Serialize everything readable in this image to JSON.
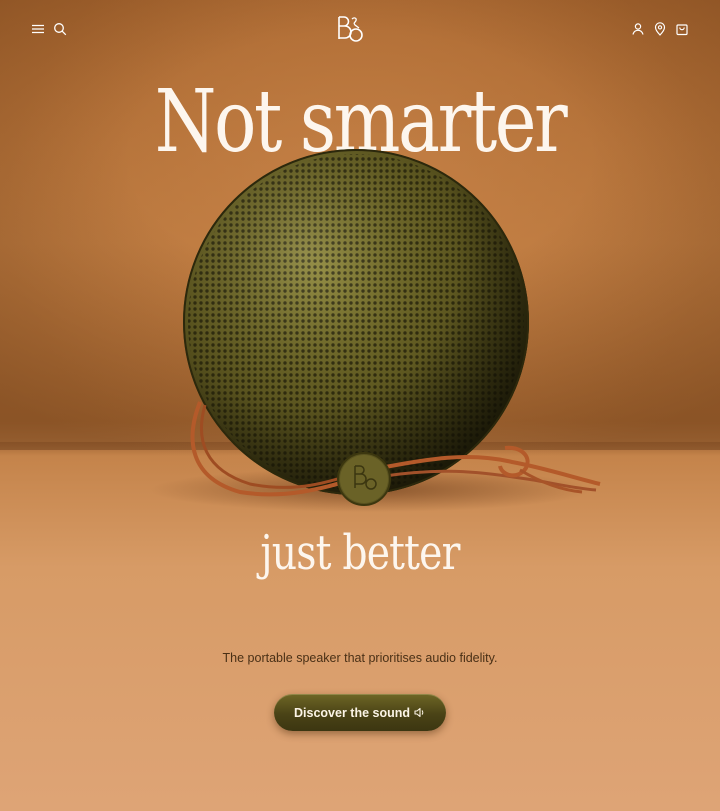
{
  "header": {
    "icons": {
      "menu": "menu-icon",
      "search": "search-icon",
      "logo": "bang-olufsen-logo",
      "account": "user-icon",
      "stores": "location-pin-icon",
      "cart": "shopping-bag-icon"
    }
  },
  "hero": {
    "headline": "Not smarter",
    "subheadline": "just better",
    "tagline": "The portable speaker that prioritises audio fidelity.",
    "cta_label": "Discover the sound",
    "cta_icon": "speaker-volume-icon"
  },
  "colors": {
    "text_light": "#fdf6ee",
    "text_dark": "#4a3016",
    "button": "#4a4316",
    "speaker": "#6b6526",
    "strap": "#b45a2a"
  }
}
